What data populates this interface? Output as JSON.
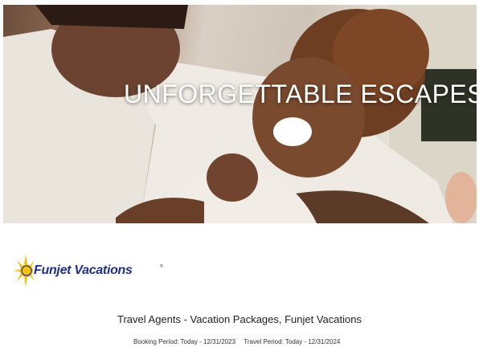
{
  "hero": {
    "title": "UNFORGETTABLE ESCAPES"
  },
  "brand": {
    "name": "Funjet Vacations",
    "tm": "®",
    "colors": {
      "navy": "#1f2f86",
      "sun": "#f4c20d"
    }
  },
  "offer": {
    "heading": "Travel Agents - Vacation Packages, Funjet Vacations",
    "booking_period": "Booking Period: Today - 12/31/2023",
    "travel_period": "Travel Period: Today - 12/31/2024"
  }
}
